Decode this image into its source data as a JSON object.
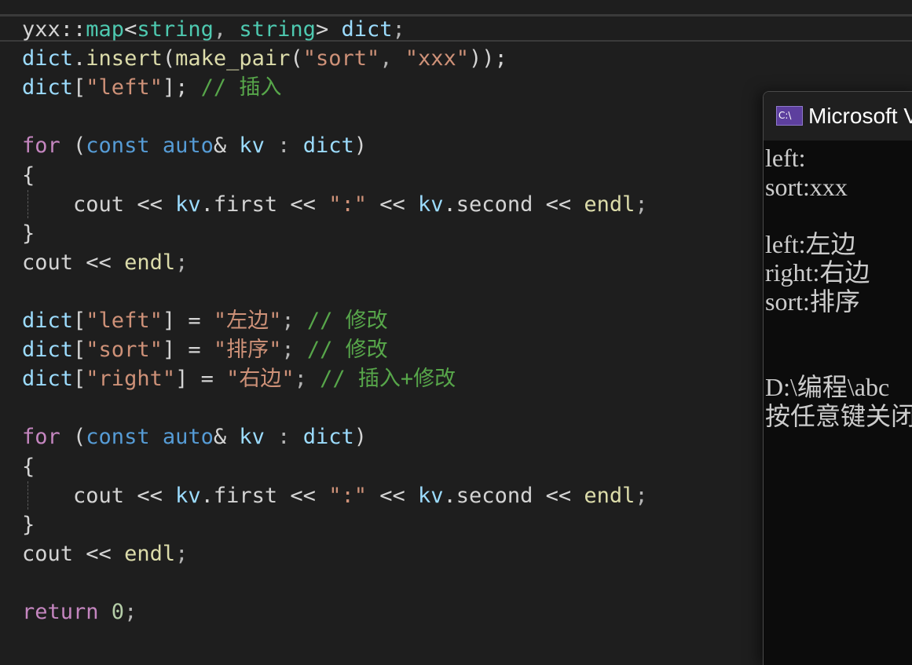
{
  "editor": {
    "lines": [
      [
        {
          "t": "yxx",
          "c": "ns"
        },
        {
          "t": "::",
          "c": "op"
        },
        {
          "t": "map",
          "c": "type"
        },
        {
          "t": "<",
          "c": "op"
        },
        {
          "t": "string",
          "c": "type"
        },
        {
          "t": ", ",
          "c": "punc"
        },
        {
          "t": "string",
          "c": "type"
        },
        {
          "t": "> ",
          "c": "op"
        },
        {
          "t": "dict",
          "c": "var"
        },
        {
          "t": ";",
          "c": "punc"
        }
      ],
      [
        {
          "t": "dict",
          "c": "var"
        },
        {
          "t": ".",
          "c": "op"
        },
        {
          "t": "insert",
          "c": "fn"
        },
        {
          "t": "(",
          "c": "op"
        },
        {
          "t": "make_pair",
          "c": "fn"
        },
        {
          "t": "(",
          "c": "op"
        },
        {
          "t": "\"sort\"",
          "c": "str"
        },
        {
          "t": ", ",
          "c": "punc"
        },
        {
          "t": "\"xxx\"",
          "c": "str"
        },
        {
          "t": "));",
          "c": "op"
        }
      ],
      [
        {
          "t": "dict",
          "c": "var"
        },
        {
          "t": "[",
          "c": "op"
        },
        {
          "t": "\"left\"",
          "c": "str"
        },
        {
          "t": "]; ",
          "c": "op"
        },
        {
          "t": "// 插入",
          "c": "comment"
        }
      ],
      [],
      [
        {
          "t": "for ",
          "c": "kw"
        },
        {
          "t": "(",
          "c": "op"
        },
        {
          "t": "const ",
          "c": "key"
        },
        {
          "t": "auto",
          "c": "key"
        },
        {
          "t": "& ",
          "c": "op"
        },
        {
          "t": "kv ",
          "c": "var"
        },
        {
          "t": ": ",
          "c": "punc"
        },
        {
          "t": "dict",
          "c": "var"
        },
        {
          "t": ")",
          "c": "op"
        }
      ],
      [
        {
          "t": "{",
          "c": "op"
        }
      ],
      [
        {
          "t": "    cout ",
          "c": "ns"
        },
        {
          "t": "<< ",
          "c": "op"
        },
        {
          "t": "kv",
          "c": "var"
        },
        {
          "t": ".",
          "c": "op"
        },
        {
          "t": "first ",
          "c": "ns"
        },
        {
          "t": "<< ",
          "c": "op"
        },
        {
          "t": "\":\" ",
          "c": "str"
        },
        {
          "t": "<< ",
          "c": "op"
        },
        {
          "t": "kv",
          "c": "var"
        },
        {
          "t": ".",
          "c": "op"
        },
        {
          "t": "second ",
          "c": "ns"
        },
        {
          "t": "<< ",
          "c": "op"
        },
        {
          "t": "endl",
          "c": "fn"
        },
        {
          "t": ";",
          "c": "punc"
        }
      ],
      [
        {
          "t": "}",
          "c": "op"
        }
      ],
      [
        {
          "t": "cout ",
          "c": "ns"
        },
        {
          "t": "<< ",
          "c": "op"
        },
        {
          "t": "endl",
          "c": "fn"
        },
        {
          "t": ";",
          "c": "punc"
        }
      ],
      [],
      [
        {
          "t": "dict",
          "c": "var"
        },
        {
          "t": "[",
          "c": "op"
        },
        {
          "t": "\"left\"",
          "c": "str"
        },
        {
          "t": "] = ",
          "c": "op"
        },
        {
          "t": "\"左边\"",
          "c": "str"
        },
        {
          "t": "; ",
          "c": "punc"
        },
        {
          "t": "// 修改",
          "c": "comment"
        }
      ],
      [
        {
          "t": "dict",
          "c": "var"
        },
        {
          "t": "[",
          "c": "op"
        },
        {
          "t": "\"sort\"",
          "c": "str"
        },
        {
          "t": "] = ",
          "c": "op"
        },
        {
          "t": "\"排序\"",
          "c": "str"
        },
        {
          "t": "; ",
          "c": "punc"
        },
        {
          "t": "// 修改",
          "c": "comment"
        }
      ],
      [
        {
          "t": "dict",
          "c": "var"
        },
        {
          "t": "[",
          "c": "op"
        },
        {
          "t": "\"right\"",
          "c": "str"
        },
        {
          "t": "] = ",
          "c": "op"
        },
        {
          "t": "\"右边\"",
          "c": "str"
        },
        {
          "t": "; ",
          "c": "punc"
        },
        {
          "t": "// 插入+修改",
          "c": "comment"
        }
      ],
      [],
      [
        {
          "t": "for ",
          "c": "kw"
        },
        {
          "t": "(",
          "c": "op"
        },
        {
          "t": "const ",
          "c": "key"
        },
        {
          "t": "auto",
          "c": "key"
        },
        {
          "t": "& ",
          "c": "op"
        },
        {
          "t": "kv ",
          "c": "var"
        },
        {
          "t": ": ",
          "c": "punc"
        },
        {
          "t": "dict",
          "c": "var"
        },
        {
          "t": ")",
          "c": "op"
        }
      ],
      [
        {
          "t": "{",
          "c": "op"
        }
      ],
      [
        {
          "t": "    cout ",
          "c": "ns"
        },
        {
          "t": "<< ",
          "c": "op"
        },
        {
          "t": "kv",
          "c": "var"
        },
        {
          "t": ".",
          "c": "op"
        },
        {
          "t": "first ",
          "c": "ns"
        },
        {
          "t": "<< ",
          "c": "op"
        },
        {
          "t": "\":\" ",
          "c": "str"
        },
        {
          "t": "<< ",
          "c": "op"
        },
        {
          "t": "kv",
          "c": "var"
        },
        {
          "t": ".",
          "c": "op"
        },
        {
          "t": "second ",
          "c": "ns"
        },
        {
          "t": "<< ",
          "c": "op"
        },
        {
          "t": "endl",
          "c": "fn"
        },
        {
          "t": ";",
          "c": "punc"
        }
      ],
      [
        {
          "t": "}",
          "c": "op"
        }
      ],
      [
        {
          "t": "cout ",
          "c": "ns"
        },
        {
          "t": "<< ",
          "c": "op"
        },
        {
          "t": "endl",
          "c": "fn"
        },
        {
          "t": ";",
          "c": "punc"
        }
      ],
      [],
      [
        {
          "t": "return ",
          "c": "kw"
        },
        {
          "t": "0",
          "c": "num"
        },
        {
          "t": ";",
          "c": "punc"
        }
      ]
    ]
  },
  "console": {
    "icon_text": "C:\\",
    "title": "Microsoft Visual Studio 调试控制台",
    "output_lines": [
      "left:",
      "sort:xxx",
      "",
      "left:左边",
      "right:右边",
      "sort:排序",
      "",
      "",
      "D:\\编程\\abc",
      "按任意键关闭"
    ]
  },
  "colors": {
    "editor_bg": "#1e1e1e",
    "console_bg": "#0c0c0c",
    "keyword": "#c586c0",
    "type": "#4ec9b0",
    "variable": "#9cdcfe",
    "function": "#dcdcaa",
    "string": "#ce9178",
    "comment": "#57a64a"
  }
}
